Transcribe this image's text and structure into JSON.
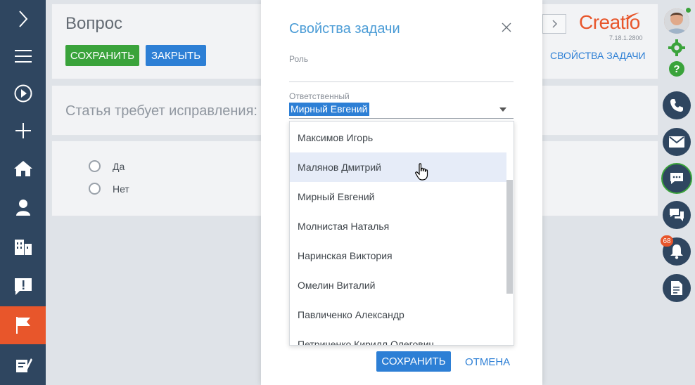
{
  "page": {
    "title": "Вопрос",
    "save_label": "СОХРАНИТЬ",
    "close_label": "ЗАКРЫТЬ",
    "question_text": "Статья требует исправления:",
    "answers": [
      "Да",
      "Нет"
    ],
    "task_props_link": "СВОЙСТВА ЗАДАЧИ"
  },
  "logo": {
    "name": "Creatio",
    "version": "7.18.1.2800"
  },
  "leftbar": {
    "items": [
      "chevron-right-icon",
      "menu-icon",
      "play-icon",
      "plus-icon",
      "home-icon",
      "user-icon",
      "building-icon",
      "alert-icon",
      "flag-icon",
      "tools-icon"
    ],
    "active": "flag-icon"
  },
  "rightbar": {
    "notifications_count": "68",
    "accent_green": "#3aa33b"
  },
  "modal": {
    "title": "Свойства задачи",
    "role_label": "Роль",
    "role_value": "",
    "responsible_label": "Ответственный",
    "responsible_value": "Мирный Евгений",
    "save_label": "СОХРАНИТЬ",
    "cancel_label": "ОТМЕНА"
  },
  "dropdown": {
    "options": [
      "Максимов Игорь",
      "Малянов Дмитрий",
      "Мирный Евгений",
      "Молнистая Наталья",
      "Наринская Виктория",
      "Омелин Виталий",
      "Павличенко Александр",
      "Петриченко Кирилл Олегович"
    ],
    "hovered": "Малянов Дмитрий"
  },
  "colors": {
    "brand": "#e8562b",
    "nav": "#2f4660",
    "primary": "#2d7fd5",
    "title_blue": "#4b9cd6"
  }
}
